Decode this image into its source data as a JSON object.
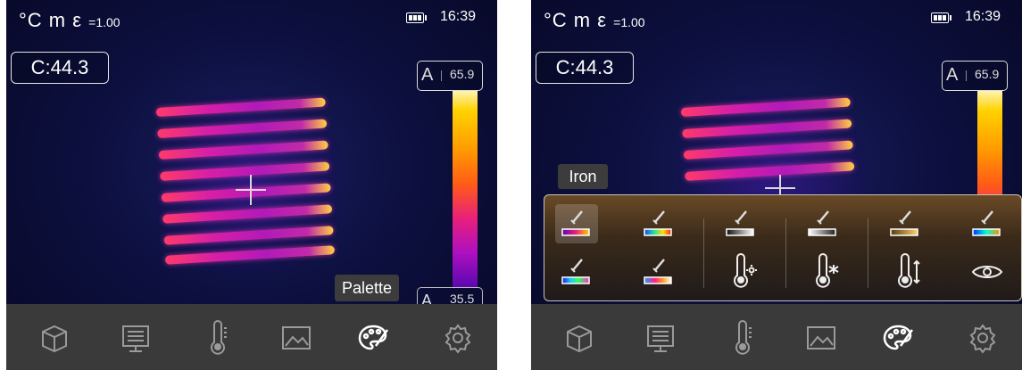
{
  "header": {
    "units": "°C m ε",
    "emissivity": "=1.00",
    "time": "16:39"
  },
  "center_reading": "C:44.3",
  "scale": {
    "auto_label": "A",
    "max": "65.9",
    "min": "35.5"
  },
  "toolbar": {
    "items": [
      "box-icon",
      "display-icon",
      "thermometer-icon",
      "image-icon",
      "palette-icon",
      "gear-icon"
    ],
    "tooltip": "Palette"
  },
  "palette_menu": {
    "tooltip": "Iron",
    "selected_index": 0,
    "row1": [
      "iron",
      "rainbow",
      "grayscale-white-hot",
      "grayscale-black-hot",
      "amber",
      "rainbow-hc"
    ],
    "row2": [
      "rainbow-2",
      "iron-2",
      "thermometer-high-alarm",
      "thermometer-low-alarm",
      "thermometer-range",
      "eye-visual"
    ]
  },
  "colors": {
    "toolbar": "#3a3a3a",
    "accent": "#ffffff"
  }
}
